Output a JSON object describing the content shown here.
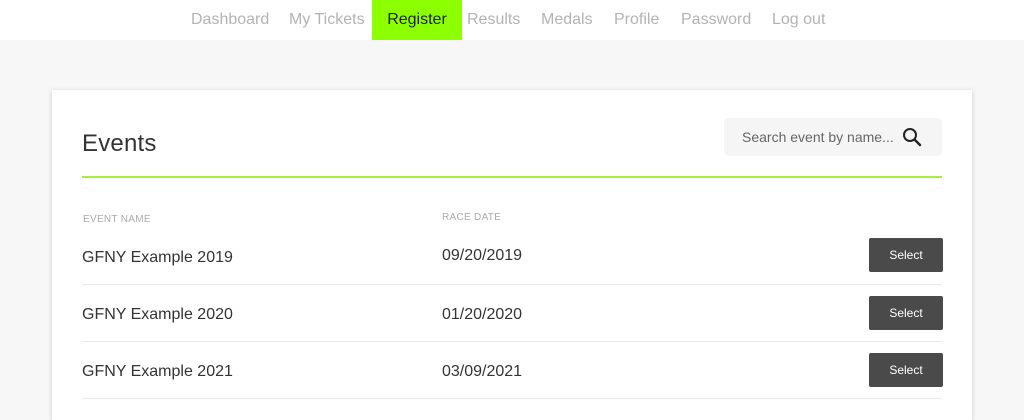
{
  "nav": {
    "items": [
      {
        "label": "Dashboard"
      },
      {
        "label": "My Tickets"
      },
      {
        "label": "Register",
        "active": true
      },
      {
        "label": "Results"
      },
      {
        "label": "Medals"
      },
      {
        "label": "Profile"
      },
      {
        "label": "Password"
      },
      {
        "label": "Log out"
      }
    ],
    "active_color": "#8cff00"
  },
  "events": {
    "title": "Events",
    "search": {
      "placeholder": "Search event by name...",
      "value": "",
      "icon": "search-icon"
    },
    "columns": {
      "name": "EVENT NAME",
      "date": "RACE DATE"
    },
    "rows": [
      {
        "name": "GFNY Example 2019",
        "date": "09/20/2019",
        "action": "Select"
      },
      {
        "name": "GFNY Example 2020",
        "date": "01/20/2020",
        "action": "Select"
      },
      {
        "name": "GFNY Example 2021",
        "date": "03/09/2021",
        "action": "Select"
      }
    ],
    "accent_color": "#a6ef3c"
  }
}
